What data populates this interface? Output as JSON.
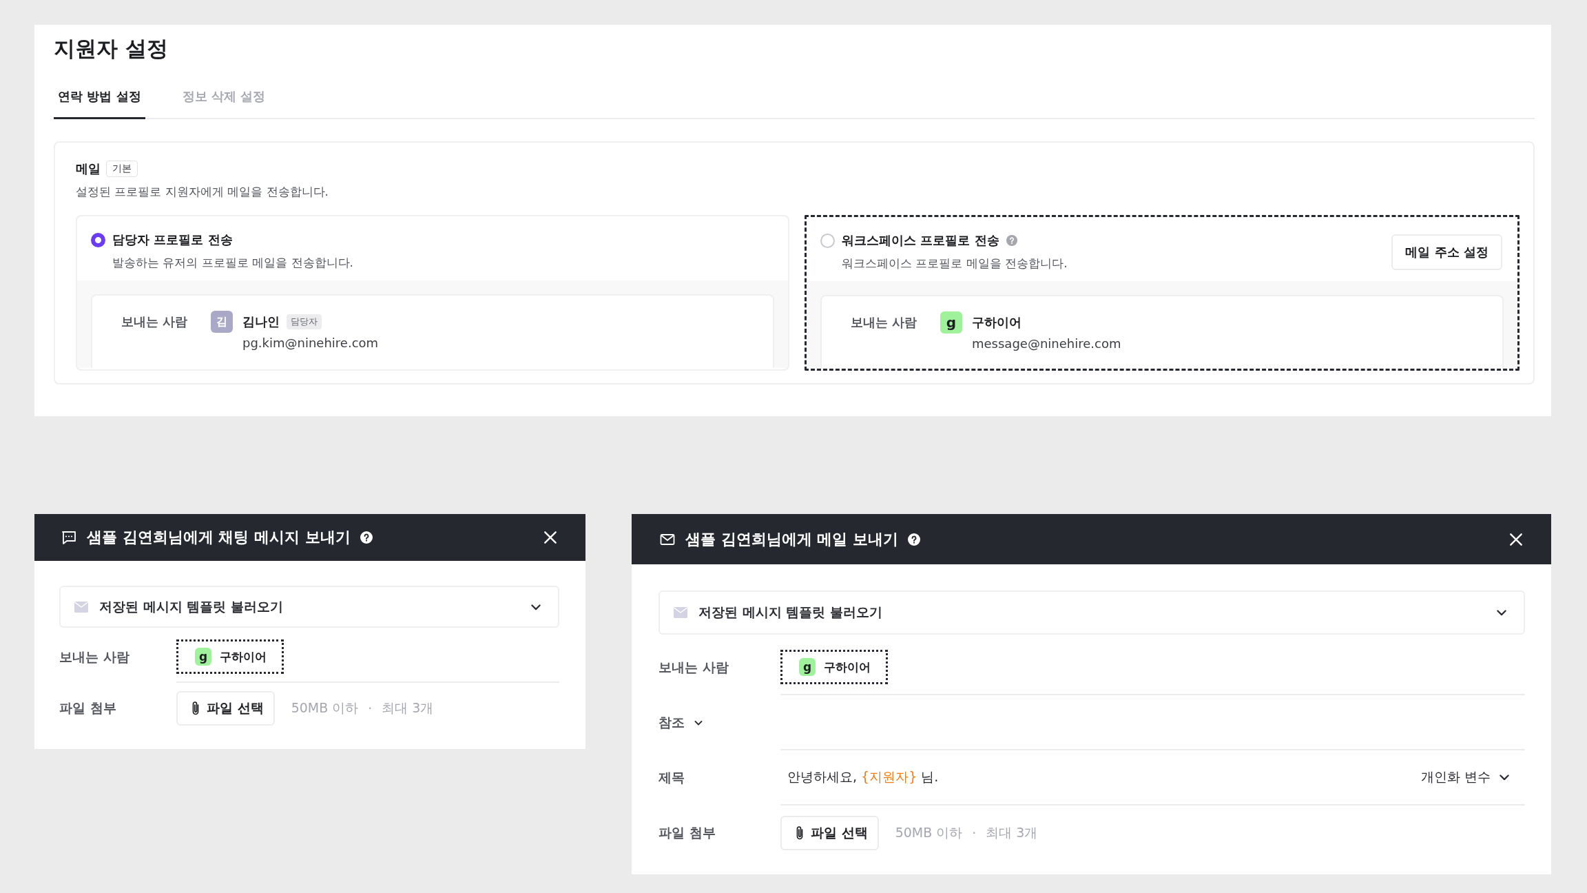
{
  "page": {
    "title": "지원자 설정"
  },
  "tabs": [
    {
      "label": "연락 방법 설정",
      "selected": true
    },
    {
      "label": "정보 삭제 설정",
      "selected": false
    }
  ],
  "email_section": {
    "title": "메일",
    "badge": "기본",
    "description": "설정된 프로필로 지원자에게 메일을 전송합니다.",
    "options": [
      {
        "label": "담당자 프로필로 전송",
        "description": "발송하는 유저의 프로필로 메일을 전송합니다.",
        "selected": true,
        "focused": false,
        "help": false,
        "sender_label": "보내는 사람",
        "sender": {
          "kind": "initial",
          "avatar": "김",
          "name": "김나인",
          "role_badge": "담당자",
          "email": "pg.kim@ninehire.com"
        }
      },
      {
        "label": "워크스페이스 프로필로 전송",
        "description": "워크스페이스 프로필로 메일을 전송합니다.",
        "selected": false,
        "focused": true,
        "help": true,
        "button": "메일 주소 설정",
        "sender_label": "보내는 사람",
        "sender": {
          "kind": "logo",
          "avatar": "g",
          "name": "구하이어",
          "email": "message@ninehire.com"
        }
      }
    ]
  },
  "dialogs": [
    {
      "kind": "chat",
      "title": "샘플 김연희님에게 채팅 메시지 보내기",
      "template_picker": "저장된 메시지 템플릿 불러오기",
      "fields": [
        {
          "kind": "sender",
          "label": "보내는 사람",
          "focused": true,
          "avatar": "g",
          "name": "구하이어"
        },
        {
          "kind": "attachment",
          "label": "파일 첨부",
          "button": "파일 선택",
          "hint_size": "50MB 이하",
          "separator": "·",
          "hint_count": "최대 3개"
        }
      ]
    },
    {
      "kind": "mail",
      "title": "샘플 김연희님에게 메일 보내기",
      "template_picker": "저장된 메시지 템플릿 불러오기",
      "fields": [
        {
          "kind": "sender",
          "label": "보내는 사람",
          "focused": true,
          "avatar": "g",
          "name": "구하이어"
        },
        {
          "kind": "cc",
          "label": "참조"
        },
        {
          "kind": "subject",
          "label": "제목",
          "parts": [
            {
              "kind": "plain",
              "text": "안녕하세요, "
            },
            {
              "kind": "variable",
              "text": "{지원자}"
            },
            {
              "kind": "plain",
              "text": " 님."
            }
          ],
          "variable_menu": "개인화 변수"
        },
        {
          "kind": "attachment",
          "label": "파일 첨부",
          "button": "파일 선택",
          "hint_size": "50MB 이하",
          "separator": "·",
          "hint_count": "최대 3개"
        }
      ]
    }
  ]
}
